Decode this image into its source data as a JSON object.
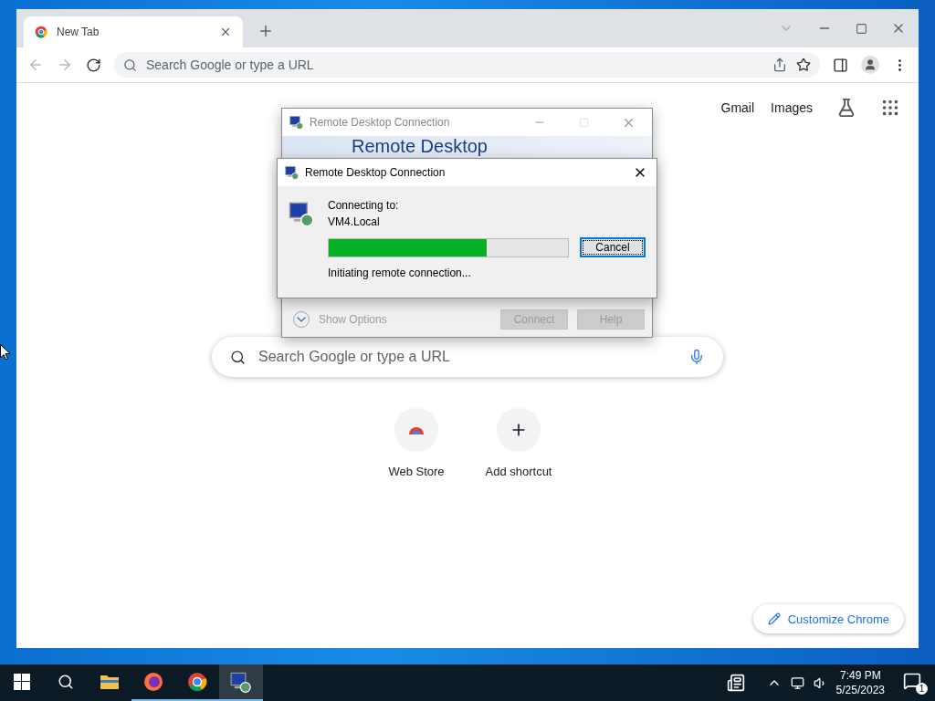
{
  "browser": {
    "tabs": [
      {
        "label": "New Tab",
        "selected": true
      }
    ],
    "address_bar": {
      "placeholder": "Search Google or type a URL"
    },
    "header_links": [
      "Gmail",
      "Images"
    ],
    "search": {
      "placeholder": "Search Google or type a URL"
    },
    "shortcuts": [
      {
        "label": "Web Store",
        "kind": "store"
      },
      {
        "label": "Add shortcut",
        "kind": "add"
      }
    ],
    "customize_button": "Customize Chrome"
  },
  "back_dialog": {
    "title": "Remote Desktop Connection",
    "banner": "Remote Desktop",
    "show_options": "Show Options",
    "buttons": [
      {
        "label": "Connect",
        "disabled": true
      },
      {
        "label": "Help",
        "disabled": true
      }
    ]
  },
  "front_dialog": {
    "title": "Remote Desktop Connection",
    "connecting_label": "Connecting to:",
    "host": "VM4.Local",
    "status": "Initiating remote connection...",
    "progress": {
      "level": 0.66
    },
    "cancel_button": "Cancel"
  },
  "taskbar": {
    "apps": [
      {
        "kind": "folder",
        "running": false,
        "selected": false
      },
      {
        "kind": "firefox",
        "running": true,
        "selected": false
      },
      {
        "kind": "chrome",
        "running": true,
        "selected": false
      },
      {
        "kind": "rdp",
        "running": true,
        "selected": true
      }
    ],
    "time": "7:49 PM",
    "date": "5/25/2023",
    "notifications": "1"
  }
}
